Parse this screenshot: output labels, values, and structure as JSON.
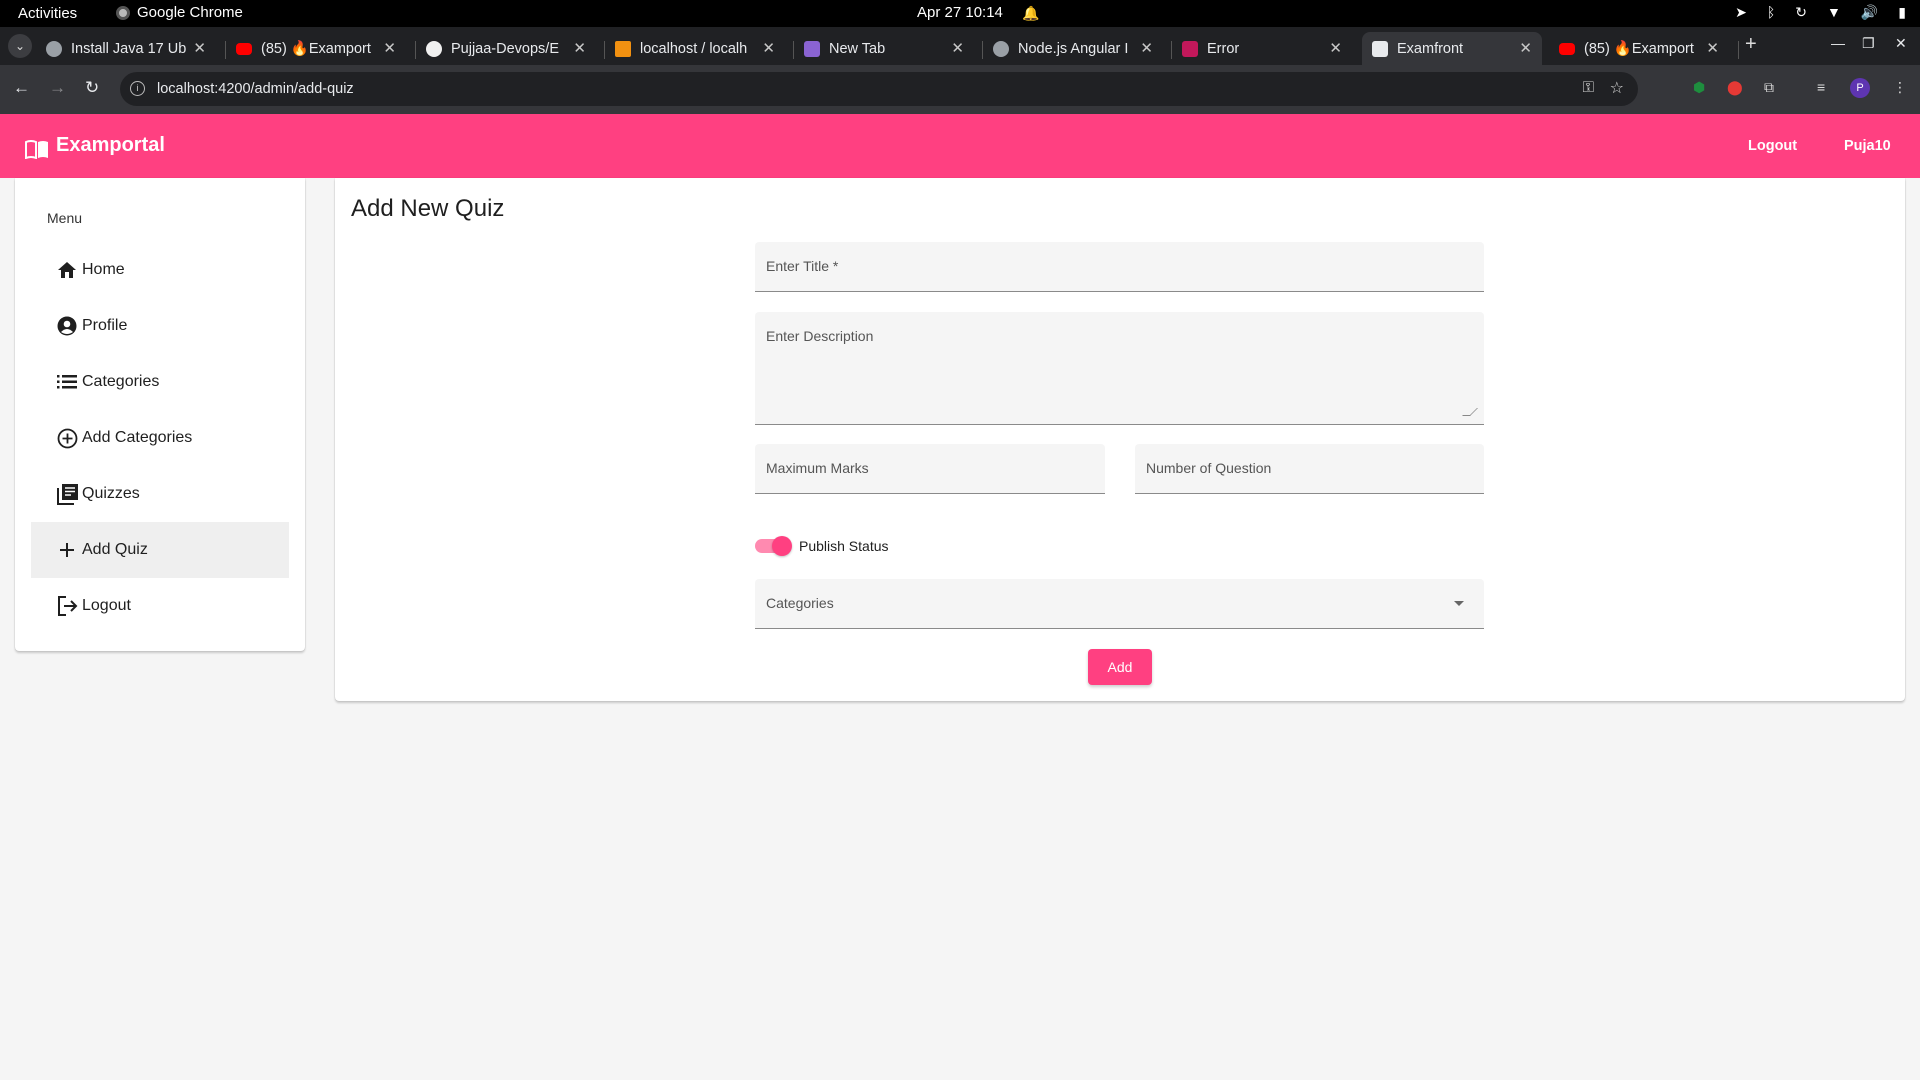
{
  "gnome": {
    "activities": "Activities",
    "app_name": "Google Chrome",
    "clock": "Apr 27  10:14"
  },
  "browser": {
    "tabs": [
      {
        "title": "Install Java 17 Ub",
        "favicon": "globe-icon"
      },
      {
        "title": "(85) 🔥Examport",
        "favicon": "youtube-icon"
      },
      {
        "title": "Pujjaa-Devops/E",
        "favicon": "github-icon"
      },
      {
        "title": "localhost / localh",
        "favicon": "phpmyadmin-icon"
      },
      {
        "title": "New Tab",
        "favicon": "newtab-icon"
      },
      {
        "title": "Node.js Angular I",
        "favicon": "globe-icon"
      },
      {
        "title": "Error",
        "favicon": "angular-icon"
      },
      {
        "title": "Examfront",
        "favicon": "angular-icon"
      },
      {
        "title": "(85) 🔥Examport",
        "favicon": "youtube-icon"
      }
    ],
    "url": "localhost:4200/admin/add-quiz",
    "profile_initial": "P"
  },
  "navbar": {
    "brand": "Examportal",
    "logout": "Logout",
    "user": "Puja10"
  },
  "sidebar": {
    "menu_label": "Menu",
    "items": [
      {
        "label": "Home",
        "icon": "home-icon"
      },
      {
        "label": "Profile",
        "icon": "account-circle-icon"
      },
      {
        "label": "Categories",
        "icon": "list-icon"
      },
      {
        "label": "Add Categories",
        "icon": "add-circle-icon"
      },
      {
        "label": "Quizzes",
        "icon": "library-books-icon"
      },
      {
        "label": "Add Quiz",
        "icon": "add-icon"
      },
      {
        "label": "Logout",
        "icon": "logout-icon"
      }
    ]
  },
  "form": {
    "page_title": "Add New Quiz",
    "title_placeholder": "Enter Title *",
    "description_placeholder": "Enter Description",
    "max_marks_placeholder": "Maximum Marks",
    "num_questions_placeholder": "Number of Question",
    "publish_label": "Publish Status",
    "publish_on": true,
    "categories_placeholder": "Categories",
    "submit_label": "Add"
  },
  "colors": {
    "primary": "#ff4081",
    "toggle_track": "#ff8ab0",
    "active_menu_bg": "#efefef"
  }
}
